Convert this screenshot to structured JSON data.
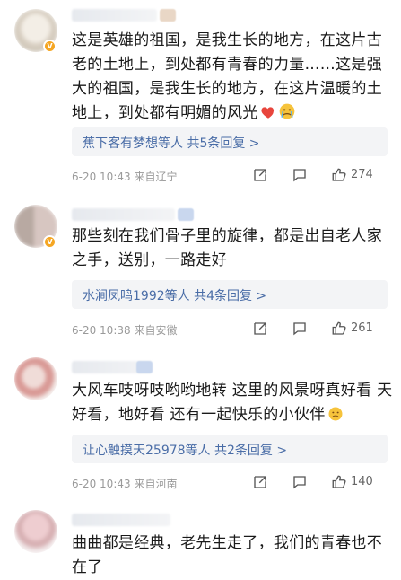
{
  "comments": [
    {
      "text": "这是英雄的祖国，是我生长的地方，在这片古老的土地上，到处都有青春的力量……这是强大的祖国，是我生长的地方，在这片温暖的土地上，到处都有明媚的风光",
      "emojis": [
        "heart",
        "crying-face"
      ],
      "reply_summary": "蕉下客有梦想等人  共5条回复 >",
      "meta": "6-20 10:43 来自辽宁",
      "likes": "274"
    },
    {
      "text": "那些刻在我们骨子里的旋律，都是出自老人家之手，送别，一路走好",
      "emojis": [],
      "reply_summary": "水涧凤鸣1992等人  共4条回复 >",
      "meta": "6-20 10:38 来自安徽",
      "likes": "261"
    },
    {
      "text": "大风车吱呀吱哟哟地转 这里的风景呀真好看 天好看，地好看 还有一起快乐的小伙伴",
      "emojis": [
        "sad-face"
      ],
      "reply_summary": "让心触摸天25978等人  共2条回复 >",
      "meta": "6-20 10:43 来自河南",
      "likes": "140"
    },
    {
      "text": "曲曲都是经典，老先生走了，我们的青春也不在了",
      "emojis": [],
      "reply_summary": "",
      "meta": "",
      "likes": ""
    }
  ],
  "colors": {
    "link": "#4a6da7",
    "meta": "#9a9a9a",
    "reply_bg": "#f3f4f6",
    "badge": "#f5a623"
  }
}
